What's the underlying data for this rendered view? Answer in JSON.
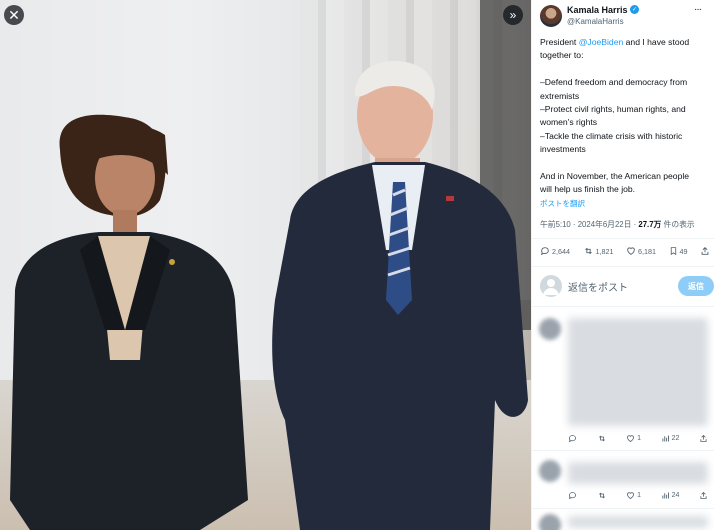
{
  "viewer": {
    "close_icon": "close-icon",
    "expand_icon": "chevrons-right-icon"
  },
  "post": {
    "author_name": "Kamala Harris",
    "author_handle": "@KamalaHarris",
    "text_line1_pre": "President ",
    "mention": "@JoeBiden",
    "text_line1_post": " and I have stood",
    "text_line2": "together to:",
    "bullet1a": "–Defend freedom and democracy from",
    "bullet1b": "extremists",
    "bullet2a": "–Protect civil rights, human rights, and",
    "bullet2b": "women's rights",
    "bullet3a": "–Tackle the climate crisis with historic",
    "bullet3b": "investments",
    "closing_a": "And in November, the American people",
    "closing_b": "will help us finish the job.",
    "translate_label": "ポストを翻訳",
    "timestamp": "午前5:10 · 2024年6月22日 · ",
    "views_count": "27.7万",
    "views_label": " 件の表示"
  },
  "actions": {
    "replies": "2,644",
    "reposts": "1,821",
    "likes": "6,181",
    "bookmarks": "49"
  },
  "reply_box": {
    "placeholder": "返信をポスト",
    "button_label": "返信"
  },
  "replies": [
    {
      "likes": "1",
      "views": "22"
    },
    {
      "likes": "1",
      "views": "24"
    }
  ],
  "colors": {
    "accent": "#1d9bf0",
    "reply_button": "#8ecdf7"
  }
}
